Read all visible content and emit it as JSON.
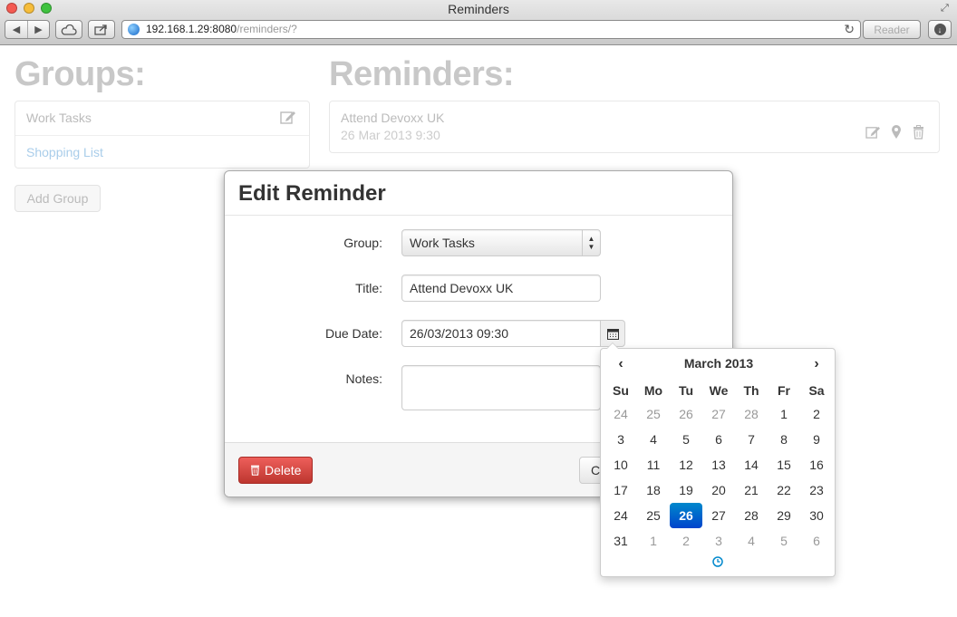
{
  "browser": {
    "window_title": "Reminders",
    "url_host": "192.168.1.29:8080",
    "url_path": "/reminders/?",
    "reader_label": "Reader"
  },
  "groups": {
    "title": "Groups:",
    "items": [
      {
        "label": "Work Tasks"
      },
      {
        "label": "Shopping List"
      }
    ],
    "add_label": "Add Group"
  },
  "reminders": {
    "title": "Reminders:",
    "items": [
      {
        "title": "Attend Devoxx UK",
        "date": "26 Mar 2013 9:30"
      }
    ]
  },
  "modal": {
    "title": "Edit Reminder",
    "group_label": "Group:",
    "group_value": "Work Tasks",
    "title_label": "Title:",
    "title_value": "Attend Devoxx UK",
    "due_label": "Due Date:",
    "due_value": "26/03/2013 09:30",
    "notes_label": "Notes:",
    "notes_value": "",
    "delete_label": "Delete",
    "cancel_label": "C"
  },
  "datepicker": {
    "prev": "‹",
    "next": "›",
    "month_label": "March 2013",
    "weekdays": [
      "Su",
      "Mo",
      "Tu",
      "We",
      "Th",
      "Fr",
      "Sa"
    ],
    "days": [
      {
        "d": "24",
        "old": true
      },
      {
        "d": "25",
        "old": true
      },
      {
        "d": "26",
        "old": true
      },
      {
        "d": "27",
        "old": true
      },
      {
        "d": "28",
        "old": true
      },
      {
        "d": "1"
      },
      {
        "d": "2"
      },
      {
        "d": "3"
      },
      {
        "d": "4"
      },
      {
        "d": "5"
      },
      {
        "d": "6"
      },
      {
        "d": "7"
      },
      {
        "d": "8"
      },
      {
        "d": "9"
      },
      {
        "d": "10"
      },
      {
        "d": "11"
      },
      {
        "d": "12"
      },
      {
        "d": "13"
      },
      {
        "d": "14"
      },
      {
        "d": "15"
      },
      {
        "d": "16"
      },
      {
        "d": "17"
      },
      {
        "d": "18"
      },
      {
        "d": "19"
      },
      {
        "d": "20"
      },
      {
        "d": "21"
      },
      {
        "d": "22"
      },
      {
        "d": "23"
      },
      {
        "d": "24"
      },
      {
        "d": "25"
      },
      {
        "d": "26",
        "active": true
      },
      {
        "d": "27"
      },
      {
        "d": "28"
      },
      {
        "d": "29"
      },
      {
        "d": "30"
      },
      {
        "d": "31"
      },
      {
        "d": "1",
        "old": true
      },
      {
        "d": "2",
        "old": true
      },
      {
        "d": "3",
        "old": true
      },
      {
        "d": "4",
        "old": true
      },
      {
        "d": "5",
        "old": true
      },
      {
        "d": "6",
        "old": true
      }
    ],
    "accent_color": "#0088cc"
  },
  "colors": {
    "delete_button": "#da4f49",
    "section_title": "#c8c8c8",
    "link": "#a9cdea"
  }
}
